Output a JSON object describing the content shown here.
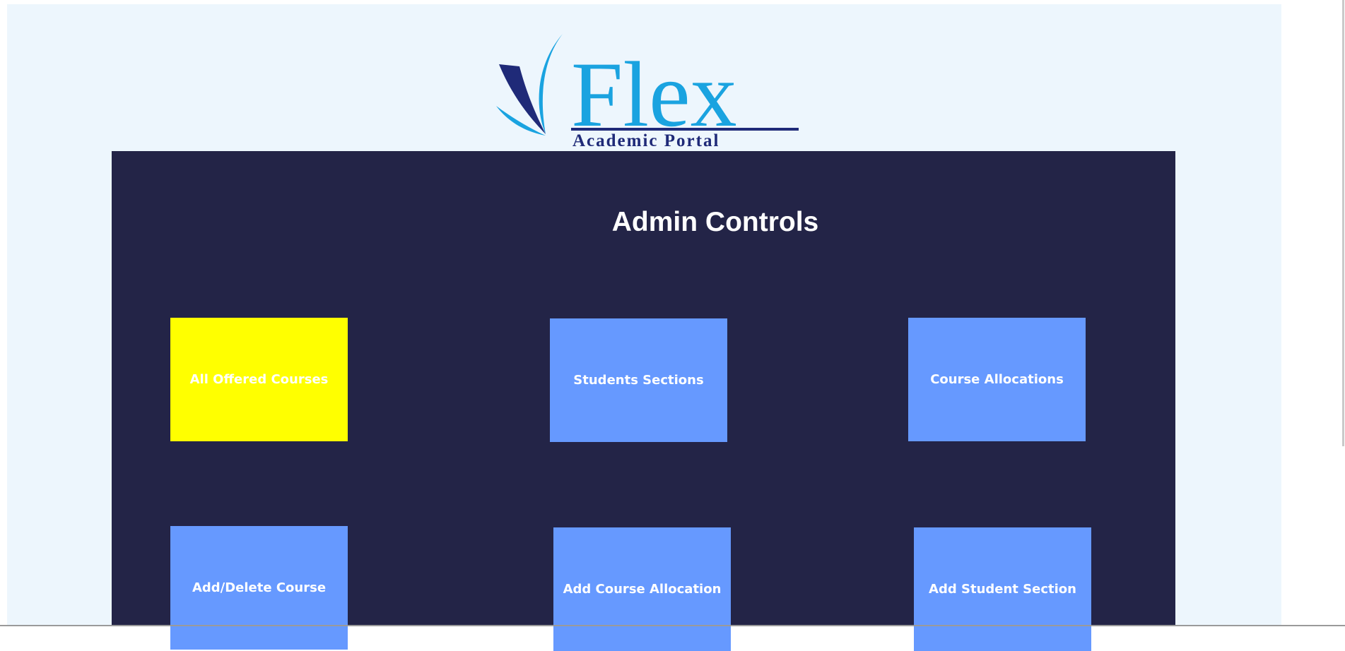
{
  "logo": {
    "brand": "Flex",
    "tagline": "Academic Portal",
    "colors": {
      "brand_blue": "#1aa3e0",
      "navy": "#1f2a78"
    }
  },
  "panel": {
    "title": "Admin Controls",
    "background": "#232447"
  },
  "tiles": [
    {
      "label": "All Offered Courses",
      "active": true
    },
    {
      "label": "Students Sections",
      "active": false
    },
    {
      "label": "Course Allocations",
      "active": false
    },
    {
      "label": "Add/Delete Course",
      "active": false
    },
    {
      "label": "Add Course Allocation",
      "active": false
    },
    {
      "label": "Add Student Section",
      "active": false
    }
  ],
  "colors": {
    "tile_default": "#6699ff",
    "tile_active": "#ffff00",
    "page_background": "#edf6fd"
  }
}
